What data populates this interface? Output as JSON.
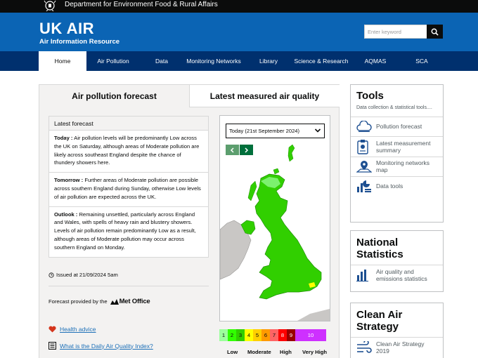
{
  "gov": {
    "department": "Department for Environment Food & Rural Affairs"
  },
  "header": {
    "title": "UK AIR",
    "subtitle": "Air Information Resource",
    "search_placeholder": "Enter keyword"
  },
  "nav": {
    "items": [
      {
        "label": "Home",
        "active": true
      },
      {
        "label": "Air Pollution"
      },
      {
        "label": "Data"
      },
      {
        "label": "Monitoring Networks"
      },
      {
        "label": "Library"
      },
      {
        "label": "Science & Research"
      },
      {
        "label": "AQMAS"
      },
      {
        "label": "SCA"
      }
    ]
  },
  "tabs": {
    "forecast": "Air pollution forecast",
    "latest": "Latest measured air quality"
  },
  "forecast": {
    "heading": "Latest forecast",
    "items": [
      {
        "label": "Today :",
        "text": " Air pollution levels will be predominantly Low across the UK on Saturday, although areas of Moderate pollution are likely across southeast England despite the chance of thundery showers here."
      },
      {
        "label": "Tomorrow :",
        "text": " Further areas of Moderate pollution are possible across southern England during Sunday, otherwise Low levels of air pollution are expected across the UK."
      },
      {
        "label": "Outlook :",
        "text": " Remaining unsettled, particularly across England and Wales, with spells of heavy rain and blustery showers. Levels of air pollution remain predominantly Low as a result, although areas of Moderate pollution may occur across southern England on Monday."
      }
    ],
    "issued": "Issued at 21/09/2024 5am",
    "provided_by": "Forecast provided by the",
    "provider": "Met Office"
  },
  "links": {
    "health": "Health advice",
    "daqi": "What is the Daily Air Quality Index?"
  },
  "map": {
    "day_selected": "Today (21st September 2024)"
  },
  "scale": {
    "bands": [
      {
        "label": "1",
        "color": "#9cff9c"
      },
      {
        "label": "2",
        "color": "#31ff00"
      },
      {
        "label": "3",
        "color": "#31cf00"
      },
      {
        "label": "4",
        "color": "#ffff00"
      },
      {
        "label": "5",
        "color": "#ffcf00"
      },
      {
        "label": "6",
        "color": "#ff9a00"
      },
      {
        "label": "7",
        "color": "#ff6464"
      },
      {
        "label": "8",
        "color": "#ff0000"
      },
      {
        "label": "9",
        "color": "#990000"
      },
      {
        "label": "10",
        "color": "#ce30ff"
      }
    ],
    "levels": [
      "Low",
      "Moderate",
      "High",
      "Very High"
    ]
  },
  "tools": {
    "title": "Tools",
    "subtitle": "Data collection & statistical tools....",
    "items": [
      {
        "label": "Pollution forecast",
        "icon": "cloud-icon"
      },
      {
        "label": "Latest measurement summary",
        "icon": "clipboard-icon"
      },
      {
        "label": "Monitoring networks map",
        "icon": "map-pin-icon"
      },
      {
        "label": "Data tools",
        "icon": "chart-tools-icon"
      }
    ]
  },
  "national_stats": {
    "title": "National Statistics",
    "items": [
      {
        "label": "Air quality and emissions statistics",
        "icon": "bar-chart-icon"
      }
    ]
  },
  "clean_air": {
    "title": "Clean Air Strategy",
    "items": [
      {
        "label": "Clean Air Strategy 2019",
        "icon": "wind-icon"
      }
    ]
  },
  "colors": {
    "header_blue": "#0b64b4",
    "nav_dark": "#00306e",
    "link_blue": "#1d70b8",
    "map_green": "#31cf00"
  }
}
